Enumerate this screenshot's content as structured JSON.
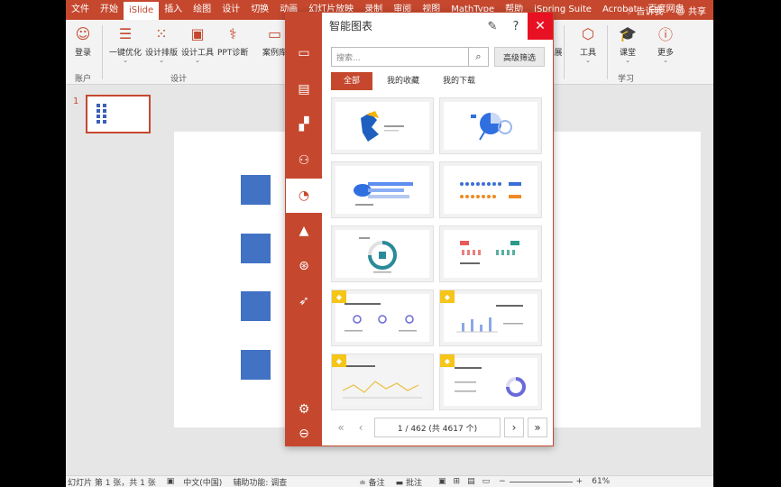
{
  "ribbon_tabs": [
    "文件",
    "开始",
    "iSlide",
    "插入",
    "绘图",
    "设计",
    "切换",
    "动画",
    "幻灯片放映",
    "录制",
    "审阅",
    "视图",
    "MathType",
    "帮助",
    "iSpring Suite",
    "Acrobat",
    "百度网盘"
  ],
  "active_tab": "iSlide",
  "tell_me": "告诉我",
  "share": "共享",
  "ribbon": {
    "login": "登录",
    "one_click": "一键优化",
    "layout": "设计排版",
    "design_tools": "设计工具",
    "ppt_diag": "PPT诊断",
    "case_lib": "案例库",
    "tools": "工具",
    "classroom": "课堂",
    "more": "更多",
    "group_account": "账户",
    "group_design": "设计",
    "group_learn": "学习",
    "partial_label": "展"
  },
  "thumb_number": "1",
  "status": {
    "slide_info": "幻灯片 第 1 张，共 1 张",
    "language": "中文(中国)",
    "accessibility": "辅助功能: 调查",
    "notes": "备注",
    "comments": "批注",
    "zoom": "61%"
  },
  "dialog": {
    "title": "智能图表",
    "search_placeholder": "搜索...",
    "advanced_filter": "高级筛选",
    "filter_tabs": [
      "全部",
      "我的收藏",
      "我的下载"
    ],
    "pager_text": "1 / 462 (共 4617 个)"
  },
  "colors": {
    "accent": "#c5482e",
    "close": "#e81123",
    "slide_shape": "#4272c4",
    "vip": "#f5c518"
  }
}
